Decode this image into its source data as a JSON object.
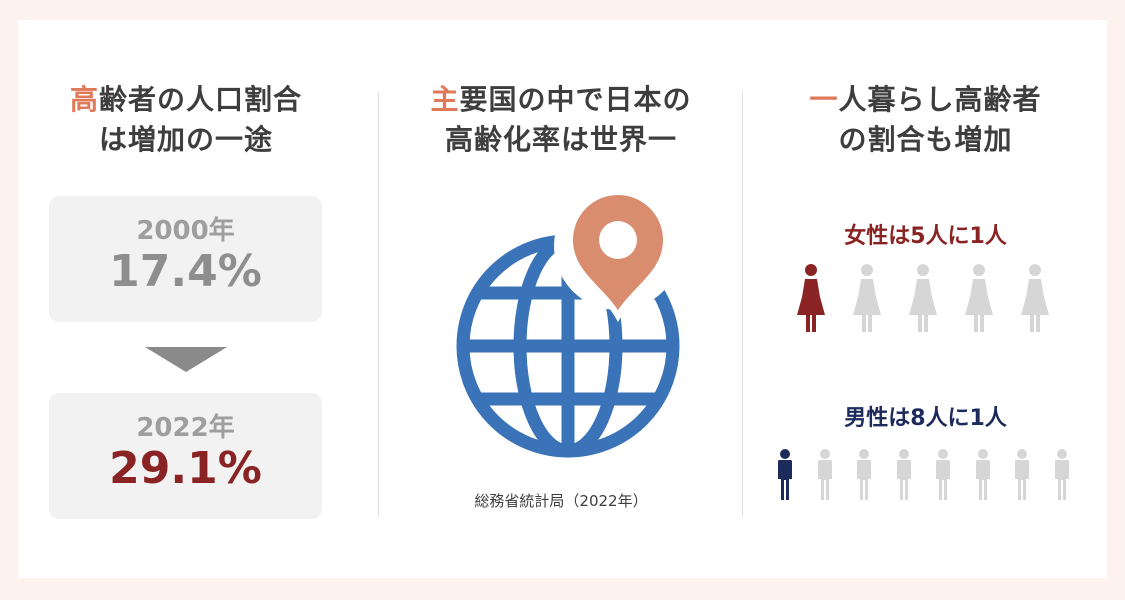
{
  "columns": [
    {
      "heading_accent": "高",
      "heading_rest_line1": "齢者の人口割合",
      "heading_line2": "は増加の一途",
      "stats": [
        {
          "year": "2000年",
          "value": "17.4%"
        },
        {
          "year": "2022年",
          "value": "29.1%"
        }
      ]
    },
    {
      "heading_accent": "主",
      "heading_rest_line1": "要国の中で日本の",
      "heading_line2": "高齢化率は世界一",
      "source": "総務省統計局（2022年）"
    },
    {
      "heading_accent": "一",
      "heading_rest_line1": "人暮らし高齢者",
      "heading_line2": "の割合も増加",
      "women": {
        "label": "女性は5人に1人",
        "highlighted": 1,
        "total": 5,
        "color": "#8a2424"
      },
      "men": {
        "label": "男性は8人に1人",
        "highlighted": 1,
        "total": 8,
        "color": "#1c2a5c"
      }
    }
  ],
  "colors": {
    "accent": "#e0785a",
    "dark_red": "#8a2424",
    "navy": "#1c2a5c",
    "globe_blue": "#3a73b8",
    "pin": "#d98c6e",
    "figure_gray": "#d6d6d6"
  },
  "icons": {
    "globe": "globe-icon",
    "pin": "location-pin-icon",
    "woman": "woman-icon",
    "man": "man-icon",
    "arrow": "down-arrow-icon"
  }
}
